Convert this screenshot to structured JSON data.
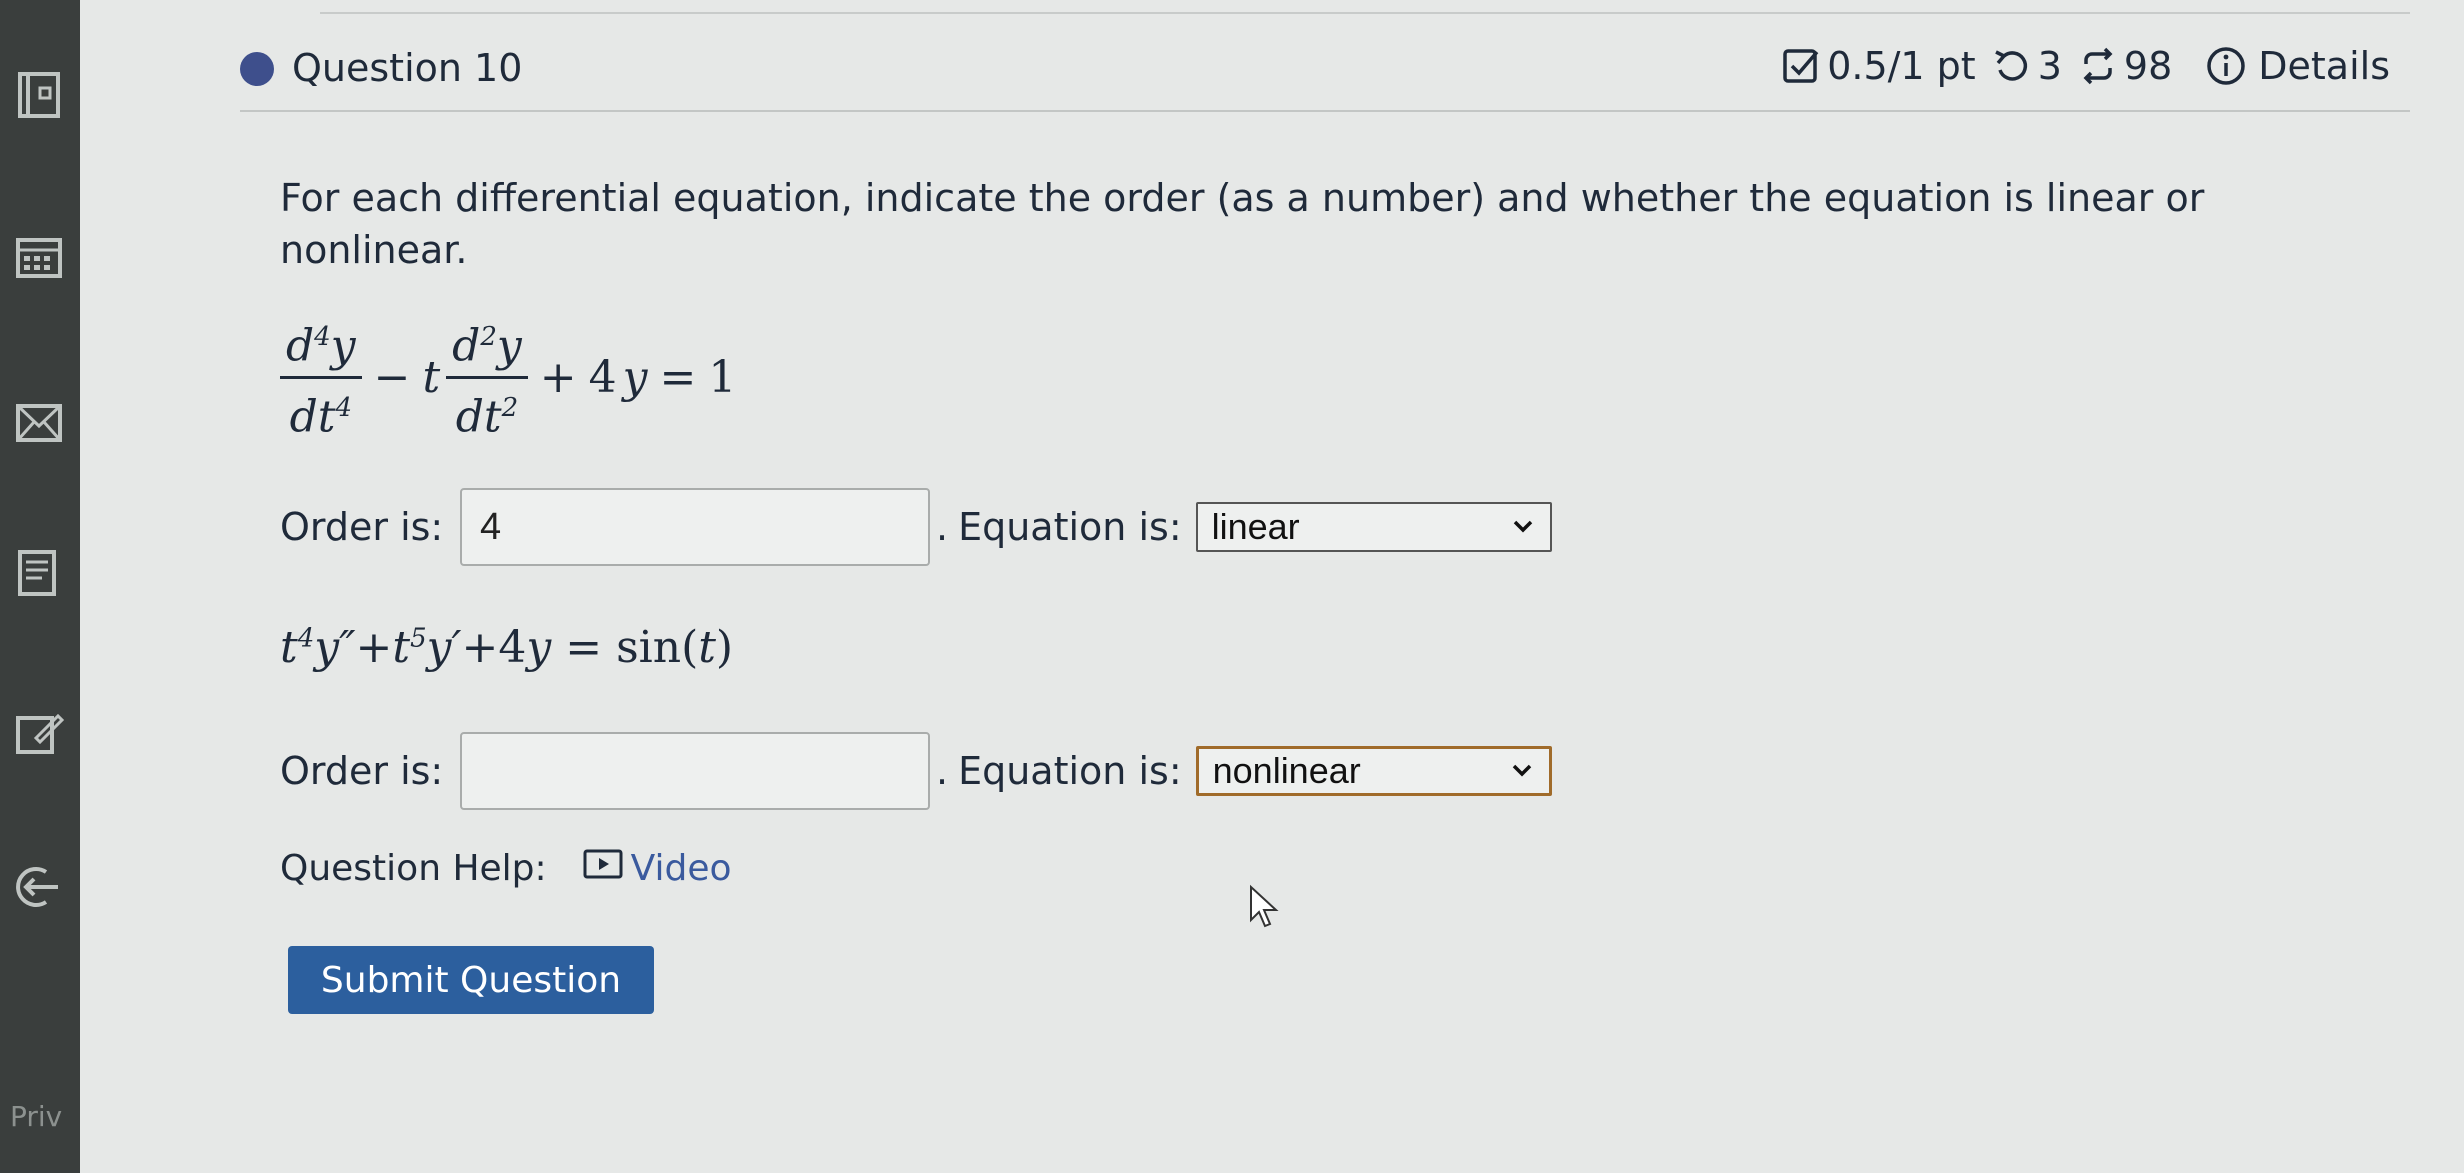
{
  "sidebar": {
    "icons": [
      "book-icon",
      "calendar-icon",
      "mail-icon",
      "notes-icon",
      "edit-icon",
      "logout-icon"
    ],
    "footer_text": "Priv"
  },
  "question": {
    "title": "Question 10",
    "score": "0.5/1 pt",
    "retries": "3",
    "attempts": "98",
    "details_label": "Details",
    "prompt": "For each differential equation, indicate the order (as a number) and whether the equation is linear or nonlinear."
  },
  "part1": {
    "order_label": "Order is:",
    "order_value": "4",
    "after_input": ".",
    "equation_label": "Equation is:",
    "equation_value": "linear"
  },
  "part2": {
    "order_label": "Order is:",
    "order_value": "",
    "after_input": ".",
    "equation_label": "Equation is:",
    "equation_value": "nonlinear"
  },
  "help": {
    "label": "Question Help:",
    "video_label": "Video"
  },
  "submit_label": "Submit Question"
}
